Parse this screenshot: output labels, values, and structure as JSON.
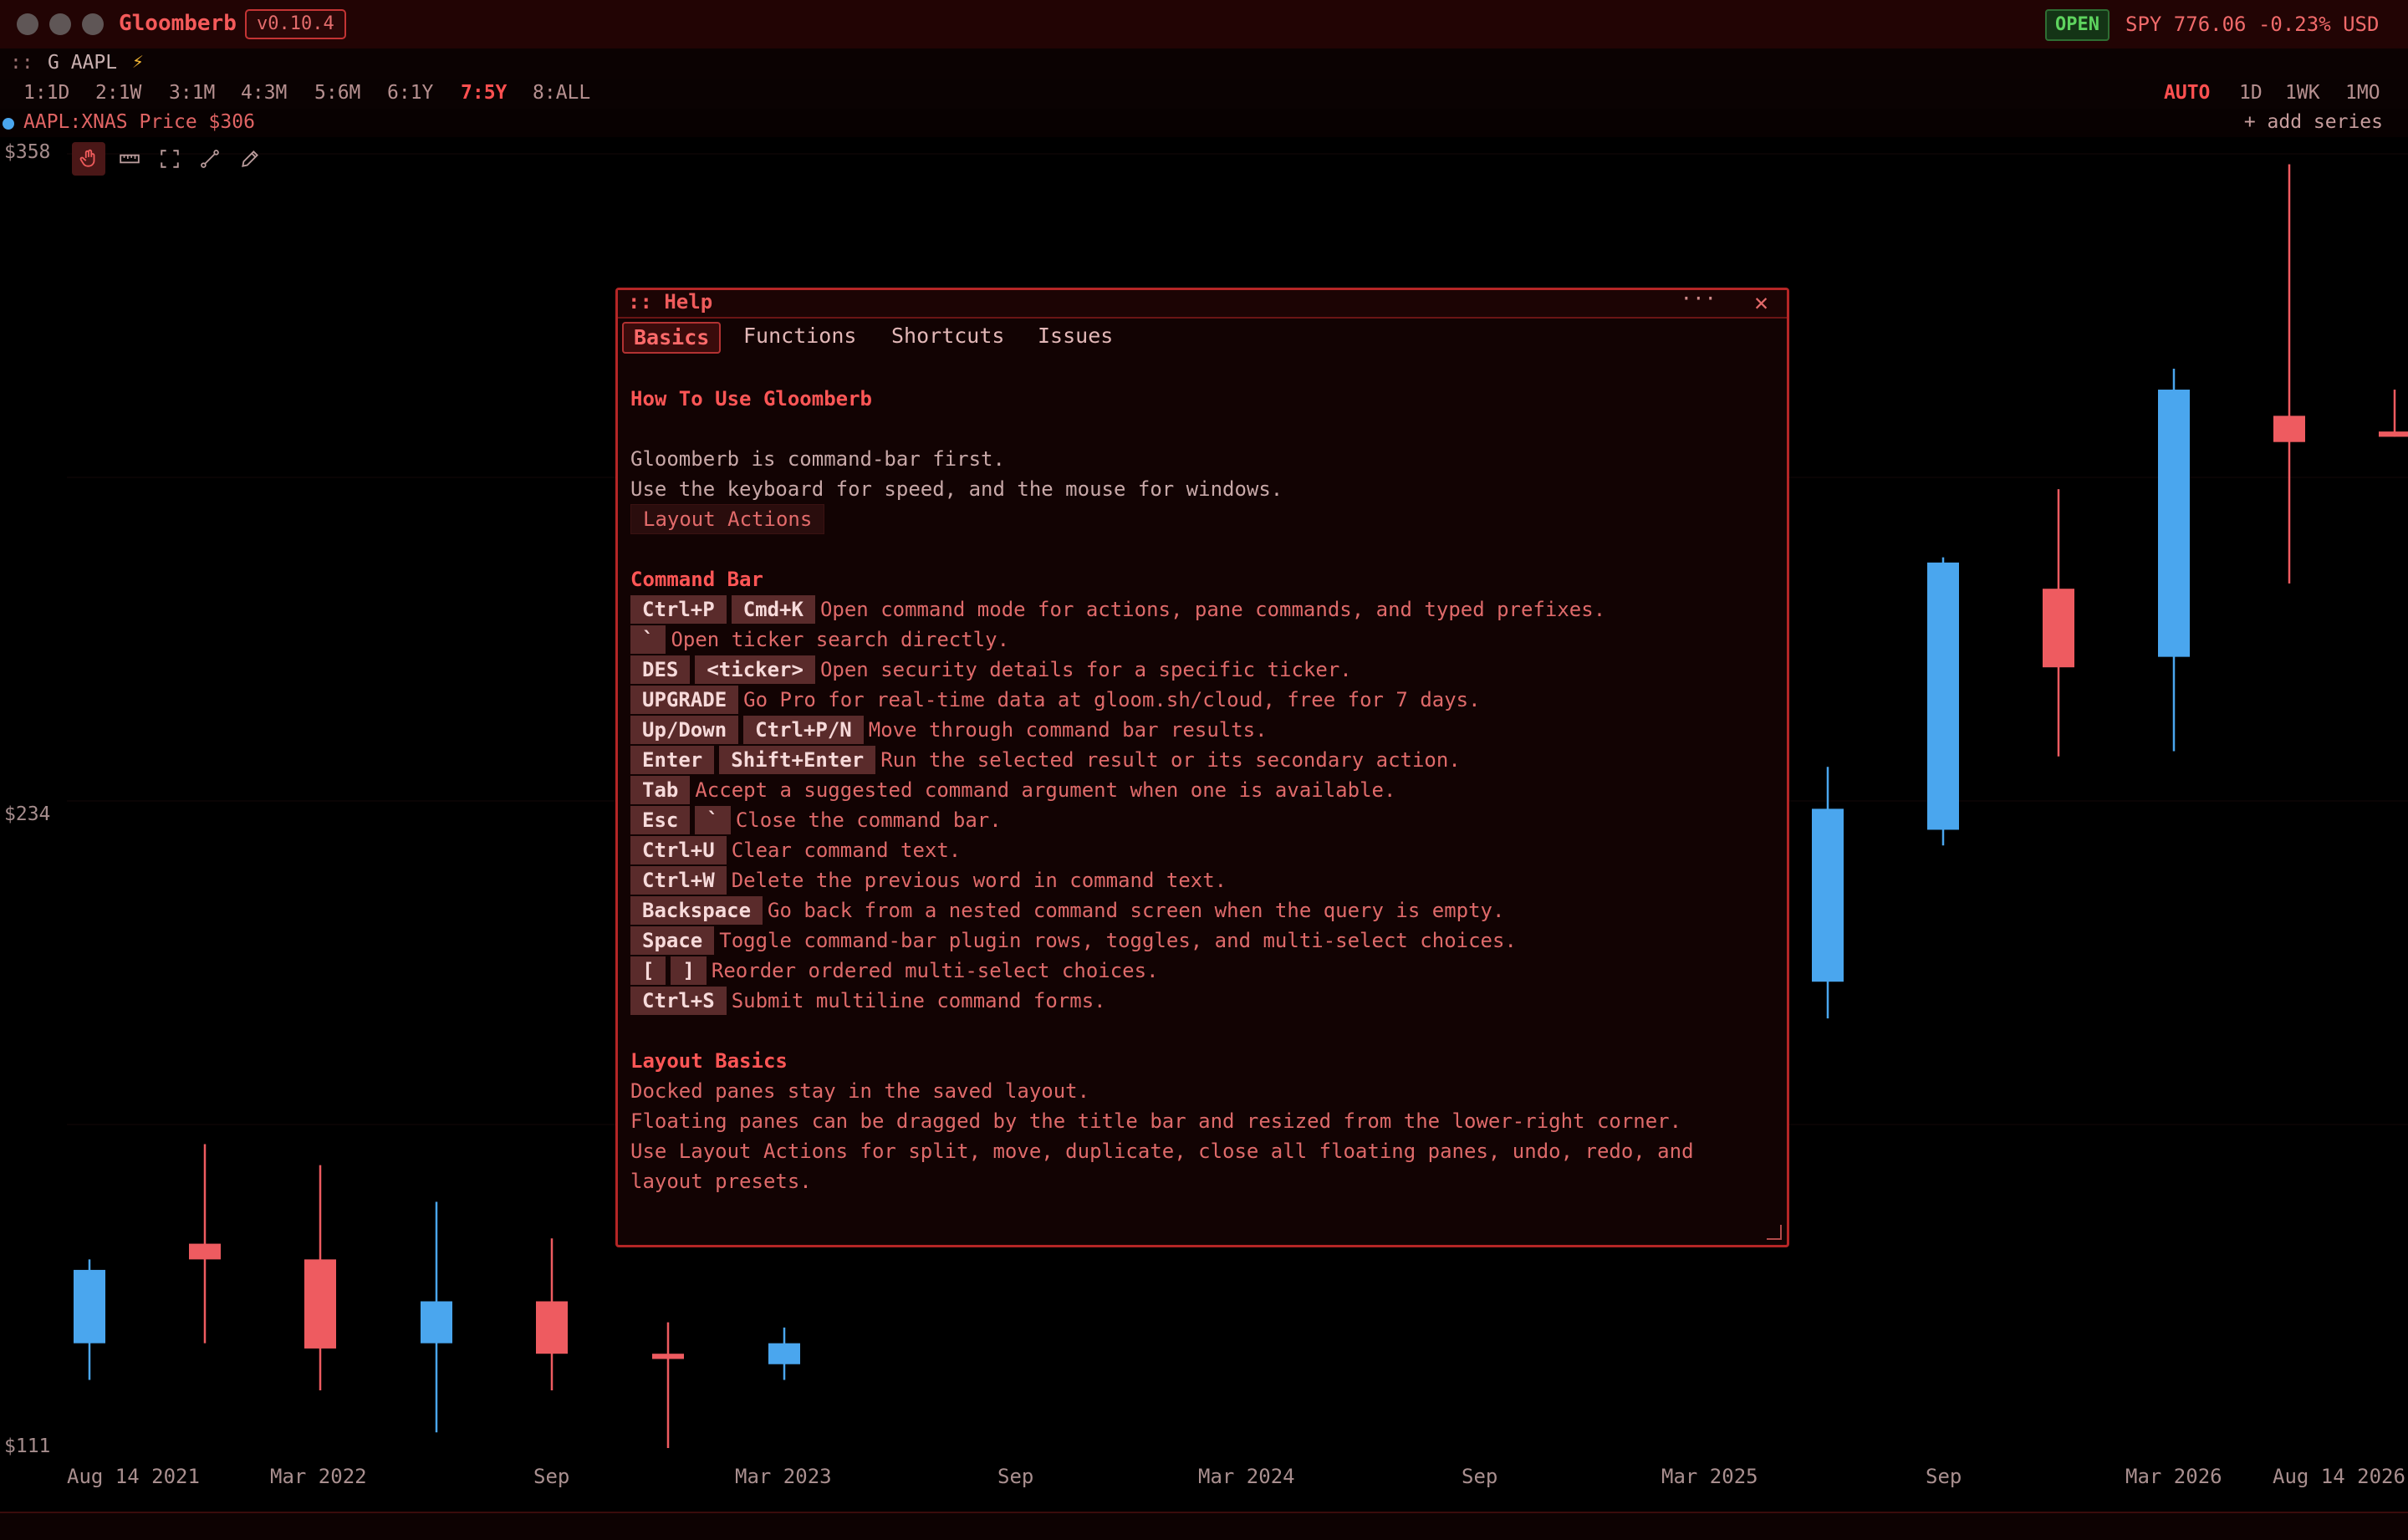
{
  "window": {
    "app_name": "Gloomberb",
    "version": "v0.10.4"
  },
  "status": {
    "market_state": "OPEN",
    "ticker_quote": "SPY 776.06 -0.23% USD"
  },
  "command": {
    "prefix": "::",
    "text": "G AAPL"
  },
  "ranges": [
    "1:1D",
    "2:1W",
    "3:1M",
    "4:3M",
    "5:6M",
    "6:1Y",
    "7:5Y",
    "8:ALL"
  ],
  "active_range": "7:5Y",
  "intervals": [
    "AUTO",
    "1D",
    "1WK",
    "1MO"
  ],
  "active_interval": "AUTO",
  "series": {
    "label": "AAPL:XNAS Price $306",
    "add_label": "+ add series"
  },
  "price_axis": [
    "$358",
    "$234",
    "$111"
  ],
  "tools": [
    "pointer-hand",
    "ruler",
    "fit-screen",
    "trendline",
    "pencil"
  ],
  "colors": {
    "up": "#4aa6ee",
    "down": "#ee5b60",
    "accent": "#ff5050",
    "background": "#020101"
  },
  "chart_data": {
    "type": "candlestick",
    "title": "",
    "x_ticks": [
      "Aug 14 2021",
      "Mar 2022",
      "Sep",
      "Mar 2023",
      "Sep",
      "Mar 2024",
      "Sep",
      "Mar 2025",
      "Sep",
      "Mar 2026",
      "Aug 14 2026"
    ],
    "y_ticks": [
      "$358",
      "$234",
      "$111"
    ],
    "ylim": [
      111,
      358
    ],
    "candles": [
      {
        "label": "Aug 14 2021",
        "open": 131,
        "high": 144,
        "low": 124,
        "close": 145,
        "dir": "up"
      },
      {
        "label": "Dec 2021",
        "open": 150,
        "high": 163,
        "low": 131,
        "close": 147,
        "dir": "down"
      },
      {
        "label": "Mar 2022",
        "open": 147,
        "high": 159,
        "low": 122,
        "close": 130,
        "dir": "down"
      },
      {
        "label": "Jun 2022",
        "open": 131,
        "high": 155,
        "low": 114,
        "close": 139,
        "dir": "up"
      },
      {
        "label": "Sep",
        "open": 139,
        "high": 145,
        "low": 122,
        "close": 129,
        "dir": "down"
      },
      {
        "label": "Dec 2022",
        "open": 129,
        "high": 129,
        "low": 111,
        "close": 128,
        "dir": "down"
      },
      {
        "label": "Mar 2023",
        "open": 127,
        "high": 131,
        "low": 124,
        "close": 131,
        "dir": "up"
      },
      {
        "label": "Jun 2025",
        "open": 200,
        "high": 238,
        "low": 193,
        "close": 233,
        "dir": "up"
      },
      {
        "label": "Sep",
        "open": 229,
        "high": 278,
        "low": 226,
        "close": 280,
        "dir": "up"
      },
      {
        "label": "Dec 2025",
        "open": 275,
        "high": 288,
        "low": 243,
        "close": 260,
        "dir": "down"
      },
      {
        "label": "Mar 2026",
        "open": 262,
        "high": 314,
        "low": 244,
        "close": 313,
        "dir": "up"
      },
      {
        "label": "Jun 2026",
        "open": 308,
        "high": 350,
        "low": 276,
        "close": 303,
        "dir": "down"
      },
      {
        "label": "Aug 14 2026",
        "open": 305,
        "high": 307,
        "low": 304,
        "close": 304,
        "dir": "down"
      }
    ]
  },
  "help": {
    "title": ":: Help",
    "menu_label": "···",
    "close_label": "✕",
    "tabs": [
      "Basics",
      "Functions",
      "Shortcuts",
      "Issues"
    ],
    "heading": "How To Use Gloomberb",
    "intro": [
      "Gloomberb is command-bar first.",
      "Use the keyboard for speed, and the mouse for windows."
    ],
    "layout_actions_label": "Layout Actions",
    "command_bar_title": "Command Bar",
    "shortcuts": [
      {
        "keys": [
          "Ctrl+P",
          "Cmd+K"
        ],
        "desc": "Open command mode for actions, pane commands, and typed prefixes."
      },
      {
        "keys": [
          "`"
        ],
        "desc": "Open ticker search directly."
      },
      {
        "keys": [
          "DES",
          "<ticker>"
        ],
        "desc": "Open security details for a specific ticker."
      },
      {
        "keys": [
          "UPGRADE"
        ],
        "desc": "Go Pro for real-time data at gloom.sh/cloud, free for 7 days."
      },
      {
        "keys": [
          "Up/Down",
          "Ctrl+P/N"
        ],
        "desc": "Move through command bar results."
      },
      {
        "keys": [
          "Enter",
          "Shift+Enter"
        ],
        "desc": "Run the selected result or its secondary action."
      },
      {
        "keys": [
          "Tab"
        ],
        "desc": "Accept a suggested command argument when one is available."
      },
      {
        "keys": [
          "Esc",
          "`"
        ],
        "desc": "Close the command bar."
      },
      {
        "keys": [
          "Ctrl+U"
        ],
        "desc": "Clear command text."
      },
      {
        "keys": [
          "Ctrl+W"
        ],
        "desc": "Delete the previous word in command text."
      },
      {
        "keys": [
          "Backspace"
        ],
        "desc": "Go back from a nested command screen when the query is empty."
      },
      {
        "keys": [
          "Space"
        ],
        "desc": "Toggle command-bar plugin rows, toggles, and multi-select choices."
      },
      {
        "keys": [
          "[",
          "]"
        ],
        "desc": "Reorder ordered multi-select choices."
      },
      {
        "keys": [
          "Ctrl+S"
        ],
        "desc": "Submit multiline command forms."
      }
    ],
    "layout_basics_title": "Layout Basics",
    "layout_basics": [
      "Docked panes stay in the saved layout.",
      "Floating panes can be dragged by the title bar and resized from the lower-right corner.",
      "Use Layout Actions for split, move, duplicate, close all floating panes, undo, redo, and",
      "layout presets."
    ]
  }
}
